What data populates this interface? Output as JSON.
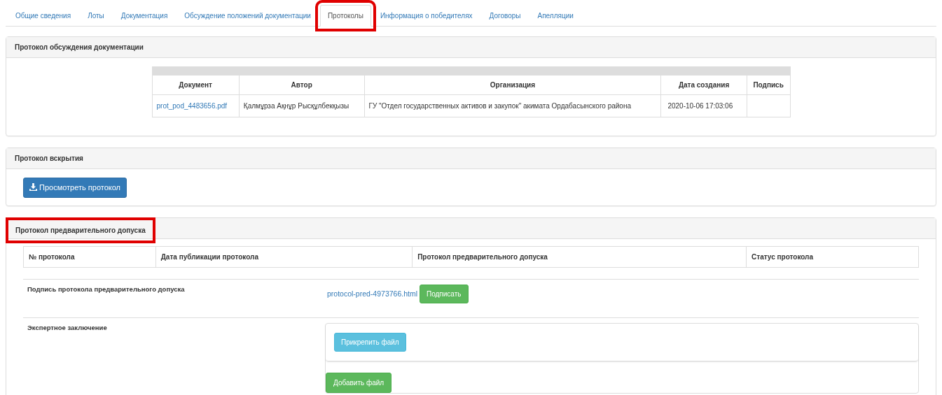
{
  "tabs": [
    {
      "label": "Общие сведения",
      "selected": false,
      "highlighted": false
    },
    {
      "label": "Лоты",
      "selected": false,
      "highlighted": false
    },
    {
      "label": "Документация",
      "selected": false,
      "highlighted": false
    },
    {
      "label": "Обсуждение положений документации",
      "selected": false,
      "highlighted": false
    },
    {
      "label": "Протоколы",
      "selected": true,
      "highlighted": true
    },
    {
      "label": "Информация о победителях",
      "selected": false,
      "highlighted": false
    },
    {
      "label": "Договоры",
      "selected": false,
      "highlighted": false
    },
    {
      "label": "Апелляции",
      "selected": false,
      "highlighted": false
    }
  ],
  "discussion_panel": {
    "title": "Протокол обсуждения документации",
    "highlighted": false,
    "table": {
      "columns": [
        "Документ",
        "Автор",
        "Организация",
        "Дата создания",
        "Подпись"
      ],
      "rows": [
        [
          "prot_pod_4483656.pdf",
          "Қалмұрза Ақнұр Рысқұлбекқызы",
          "ГУ \"Отдел государственных активов и закупок\" акимата Ордабасынского района",
          "2020-10-06 17:03:06",
          ""
        ]
      ]
    }
  },
  "opening_panel": {
    "title": "Протокол вскрытия",
    "highlighted": false,
    "button": "Просмотреть протокол"
  },
  "admission_panel": {
    "title": "Протокол предварительного допуска",
    "highlighted": true,
    "table": {
      "columns": [
        "№ протокола",
        "Дата публикации протокола",
        "Протокол предварительного допуска",
        "Статус протокола"
      ]
    },
    "signature": {
      "label": "Подпись протокола предварительного допуска",
      "file": "protocol-pred-4973766.html",
      "button": "Подписать"
    },
    "expert": {
      "label": "Экспертное заключение",
      "attach_button": "Прикрепить файл",
      "add_button": "Добавить файл"
    }
  }
}
